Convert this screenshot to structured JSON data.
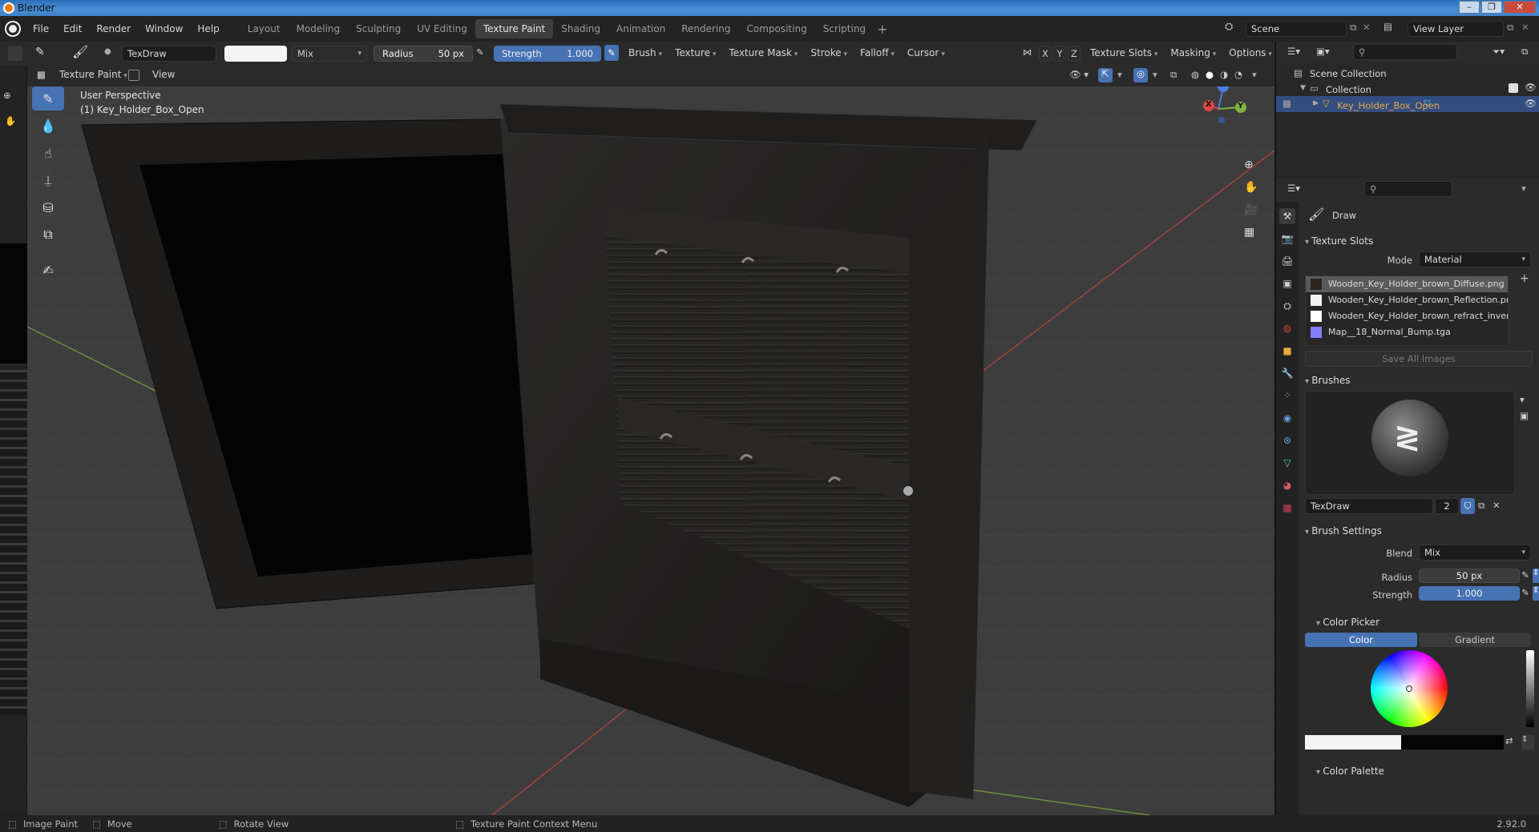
{
  "window": {
    "title": "Blender",
    "controls": [
      "–",
      "❐",
      "✕"
    ]
  },
  "menu": [
    "File",
    "Edit",
    "Render",
    "Window",
    "Help"
  ],
  "workspaces": [
    {
      "label": "Layout",
      "active": false
    },
    {
      "label": "Modeling",
      "active": false
    },
    {
      "label": "Sculpting",
      "active": false
    },
    {
      "label": "UV Editing",
      "active": false
    },
    {
      "label": "Texture Paint",
      "active": true
    },
    {
      "label": "Shading",
      "active": false
    },
    {
      "label": "Animation",
      "active": false
    },
    {
      "label": "Rendering",
      "active": false
    },
    {
      "label": "Compositing",
      "active": false
    },
    {
      "label": "Scripting",
      "active": false
    }
  ],
  "add_workspace": "+",
  "scene": {
    "label": "Scene",
    "view_layer": "View Layer"
  },
  "tool_header": {
    "brush_name": "TexDraw",
    "blend": "Mix",
    "radius_label": "Radius",
    "radius_value": "50 px",
    "strength_label": "Strength",
    "strength_value": "1.000",
    "strength_fraction": 1.0,
    "menus": [
      "Brush",
      "Texture",
      "Texture Mask",
      "Stroke",
      "Falloff",
      "Cursor"
    ],
    "axes": [
      "X",
      "Y",
      "Z"
    ],
    "right_menus": [
      "Texture Slots",
      "Masking",
      "Options"
    ]
  },
  "mode_header": {
    "mode": "Texture Paint",
    "view": "View"
  },
  "viewport": {
    "perspective": "User Perspective",
    "object": "(1) Key_Holder_Box_Open",
    "gizmo_axes": [
      "Z",
      "Y",
      "X"
    ]
  },
  "outliner": {
    "scene_collection": "Scene Collection",
    "collection": "Collection",
    "object": "Key_Holder_Box_Open"
  },
  "properties": {
    "tool_name": "Draw",
    "texture_slots_title": "Texture Slots",
    "mode_label": "Mode",
    "mode_value": "Material",
    "slots": [
      {
        "name": "Wooden_Key_Holder_brown_Diffuse.png",
        "color": "#2a2520",
        "selected": true
      },
      {
        "name": "Wooden_Key_Holder_brown_Reflection.png",
        "color": "#f2f2f2",
        "selected": false
      },
      {
        "name": "Wooden_Key_Holder_brown_refract_invert...",
        "color": "#ffffff",
        "selected": false
      },
      {
        "name": "Map__18_Normal_Bump.tga",
        "color": "#8080ff",
        "selected": false
      }
    ],
    "save_all": "Save All Images",
    "brushes_title": "Brushes",
    "brush_name": "TexDraw",
    "brush_users": "2",
    "brush_settings_title": "Brush Settings",
    "blend_label": "Blend",
    "blend_value": "Mix",
    "radius_label": "Radius",
    "radius_value": "50 px",
    "strength_label": "Strength",
    "strength_value": "1.000",
    "color_picker_title": "Color Picker",
    "color_tab": "Color",
    "gradient_tab": "Gradient",
    "color_palette_title": "Color Palette"
  },
  "status": {
    "items": [
      "Image Paint",
      "Move",
      "Rotate View",
      "Texture Paint Context Menu"
    ],
    "version": "2.92.0"
  },
  "colors": {
    "accent": "#4772b3",
    "active_object": "#e8a84a",
    "header": "#2a2a2a"
  }
}
